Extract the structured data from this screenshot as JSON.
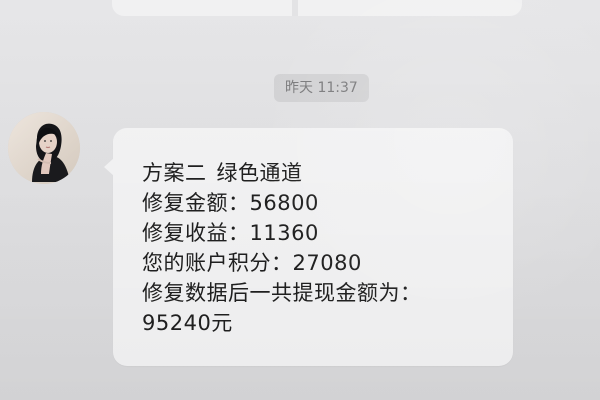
{
  "chat": {
    "timestamp": "昨天 11:37"
  },
  "message": {
    "line1_left": "方案二",
    "line1_right": "绿色通道",
    "line2": "修复金额：56800",
    "line3": "修复收益：11360",
    "line4": "您的账户积分：27080",
    "line5": "修复数据后一共提现金额为：",
    "line6": "95240元"
  },
  "icons": {
    "avatar": "avatar-photo"
  }
}
